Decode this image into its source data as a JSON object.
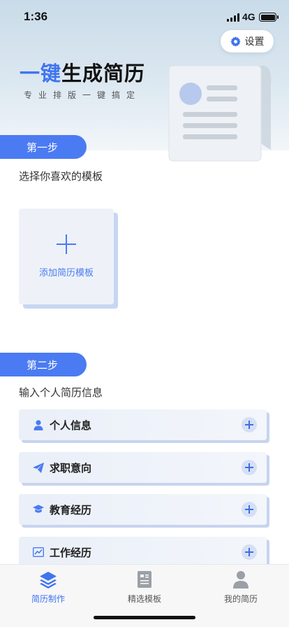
{
  "status_bar": {
    "time": "1:36",
    "network": "4G"
  },
  "header": {
    "settings_label": "设置",
    "title_accent": "一键",
    "title_rest": "生成简历",
    "subtitle": "专业排版一键搞定"
  },
  "step1": {
    "tab_label": "第一步",
    "section_label": "选择你喜欢的模板",
    "add_template_label": "添加简历模板"
  },
  "step2": {
    "tab_label": "第二步",
    "section_label": "输入个人简历信息",
    "items": [
      {
        "label": "个人信息",
        "icon": "person-icon"
      },
      {
        "label": "求职意向",
        "icon": "paper-plane-icon"
      },
      {
        "label": "教育经历",
        "icon": "graduation-cap-icon"
      },
      {
        "label": "工作经历",
        "icon": "chart-icon"
      }
    ]
  },
  "tabbar": {
    "items": [
      {
        "label": "简历制作",
        "icon": "layers-icon",
        "active": true
      },
      {
        "label": "精选模板",
        "icon": "document-icon",
        "active": false
      },
      {
        "label": "我的简历",
        "icon": "user-icon",
        "active": false
      }
    ]
  },
  "colors": {
    "accent": "#4b7bf2",
    "title_accent": "#3f74f0"
  }
}
